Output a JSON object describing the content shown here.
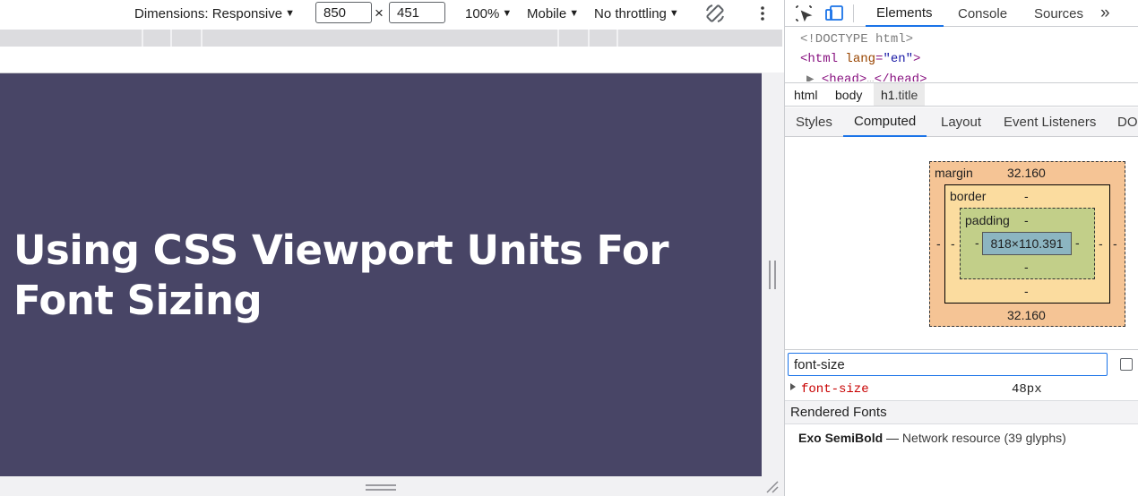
{
  "device_toolbar": {
    "dimensions_label": "Dimensions: Responsive",
    "width_value": "850",
    "times_sign": "×",
    "height_value": "451",
    "zoom_label": "100%",
    "device_type_label": "Mobile",
    "throttling_label": "No throttling",
    "rotate_icon": "rotate-icon",
    "more_icon": "kebab-icon"
  },
  "page": {
    "title": "Using CSS Viewport Units For Font Sizing",
    "background_color": "#484566",
    "text_color": "#ffffff"
  },
  "devtools": {
    "tabs": [
      "Elements",
      "Console",
      "Sources"
    ],
    "overflow_label": "»",
    "dom_lines": {
      "doctype": "<!DOCTYPE html>",
      "html_open_tag": "<html",
      "html_attr_name": "lang",
      "html_attr_value": "\"en\"",
      "html_open_close": ">",
      "head_partial": "<head>",
      "head_ellipsis": "…",
      "head_close": "</head>"
    },
    "breadcrumb": {
      "html": "html",
      "body": "body",
      "h1_tag": "h1",
      "h1_class": ".title"
    },
    "sub_tabs": [
      "Styles",
      "Computed",
      "Layout",
      "Event Listeners",
      "DO"
    ],
    "box_model": {
      "margin_label": "margin",
      "margin_top": "32.160",
      "margin_bottom": "32.160",
      "margin_left": "-",
      "margin_right": "-",
      "border_label": "border",
      "border_top": "-",
      "border_bottom": "-",
      "border_left": "-",
      "border_right": "-",
      "padding_label": "padding",
      "padding_top": "-",
      "padding_bottom": "-",
      "padding_left": "-",
      "padding_right": "-",
      "content_size": "818×110.391"
    },
    "filter": {
      "value": "font-size"
    },
    "computed_property": {
      "name": "font-size",
      "value": "48px"
    },
    "rendered_fonts": {
      "header": "Rendered Fonts",
      "font_name": "Exo SemiBold",
      "dash": "—",
      "source": "Network resource (39 glyphs)"
    },
    "colors": {
      "accent": "#1a73e8",
      "margin": "#f5c495",
      "border": "#fbdc9f",
      "padding": "#c2cf89",
      "content": "#8cb5c1"
    }
  }
}
